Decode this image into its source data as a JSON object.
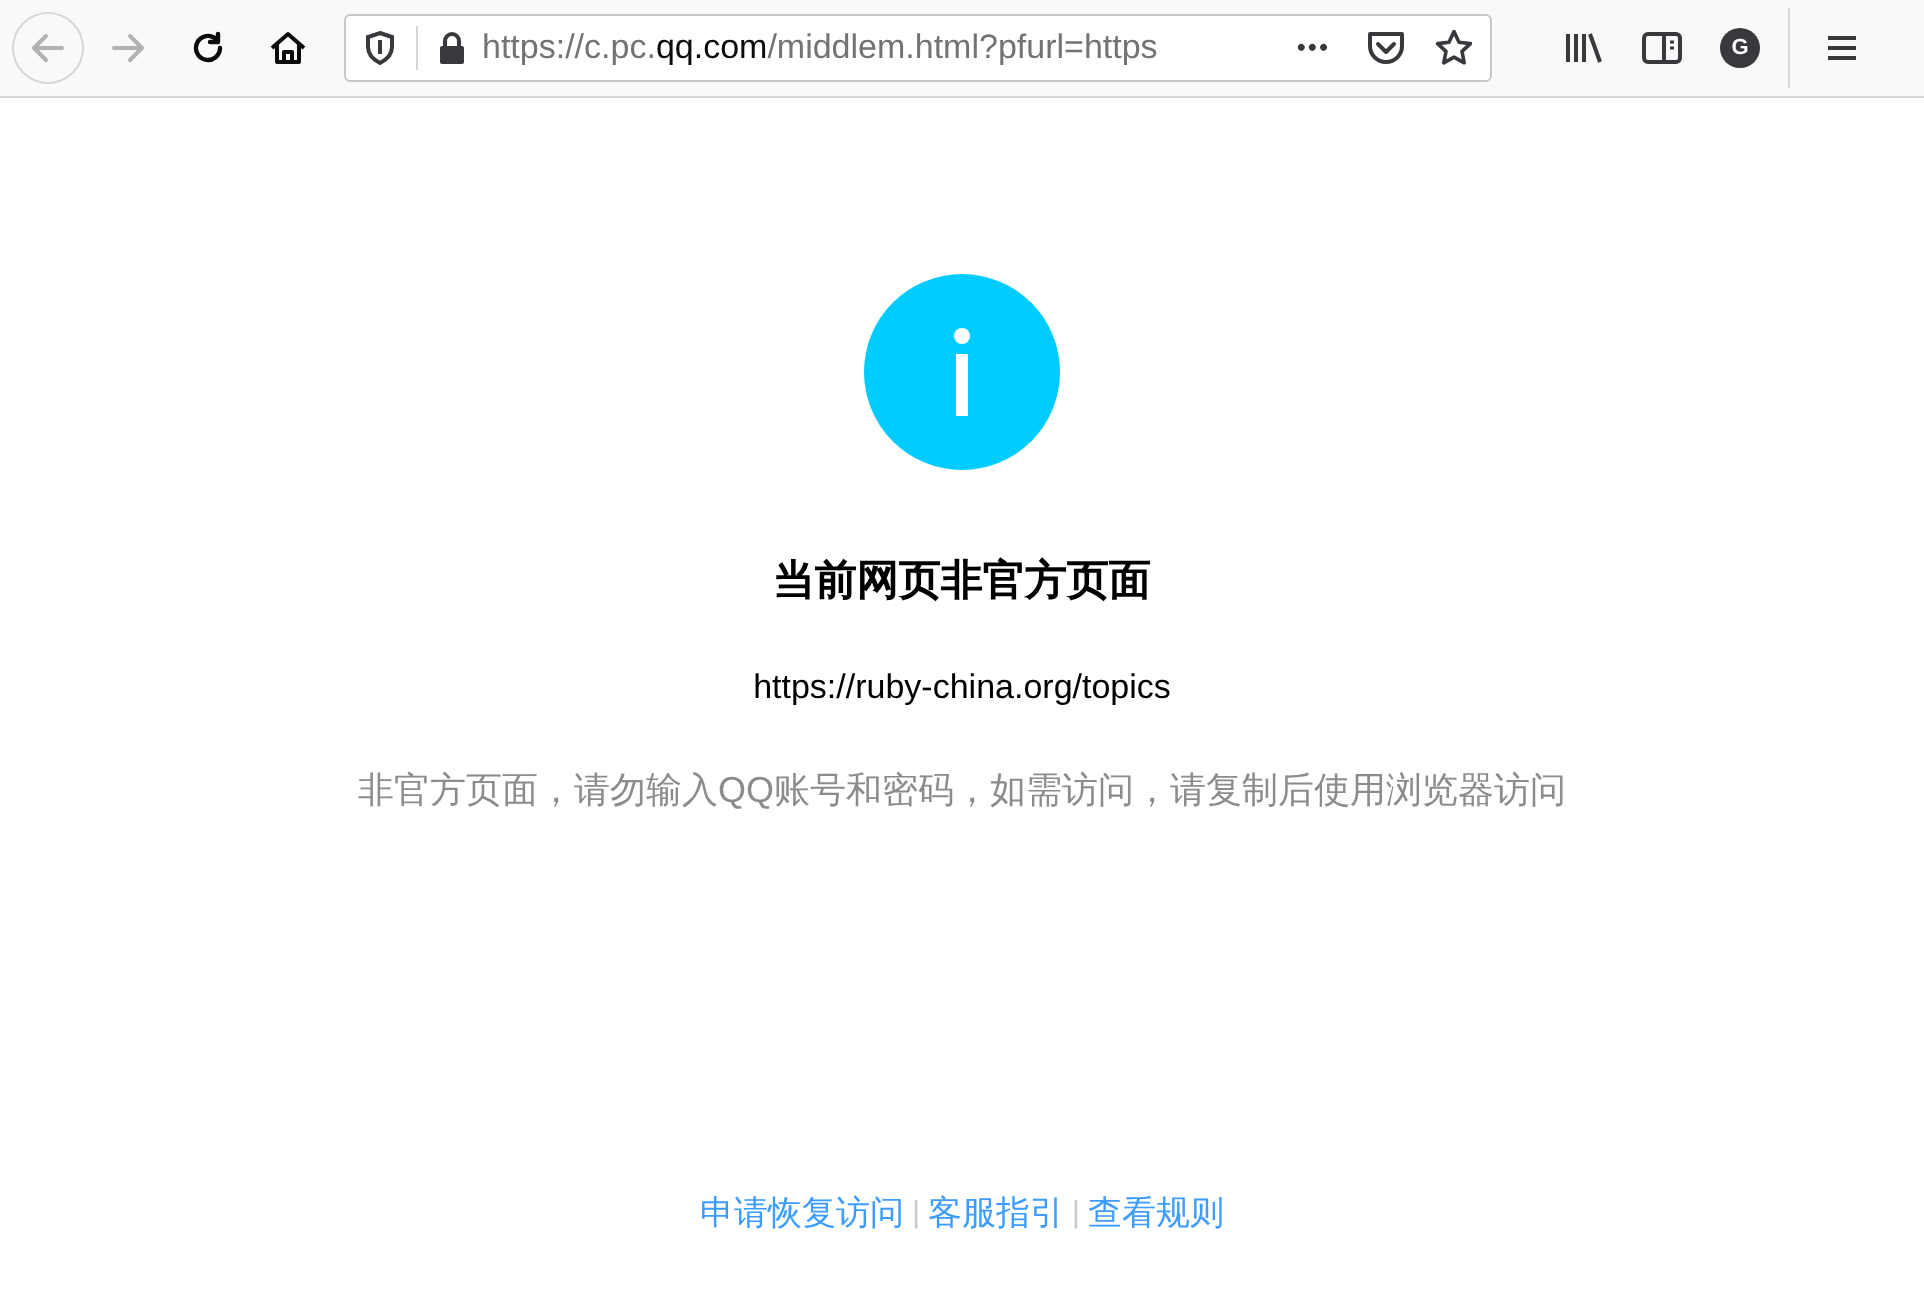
{
  "toolbar": {
    "back_disabled": true,
    "forward_disabled": true,
    "url": {
      "prefix": "https://c.pc.",
      "domain": "qq.com",
      "rest": "/middlem.html?pfurl=https"
    },
    "avatar_letter": "G",
    "more": "•••"
  },
  "page": {
    "title": "当前网页非官方页面",
    "link_url": "https://ruby-china.org/topics",
    "warning": "非官方页面，请勿输入QQ账号和密码，如需访问，请复制后使用浏览器访问"
  },
  "footer": [
    {
      "kind": "link",
      "text": "申请恢复访问"
    },
    {
      "kind": "separator",
      "text": "|"
    },
    {
      "kind": "link",
      "text": "客服指引"
    },
    {
      "kind": "separator",
      "text": "|"
    },
    {
      "kind": "link",
      "text": "查看规则"
    }
  ]
}
